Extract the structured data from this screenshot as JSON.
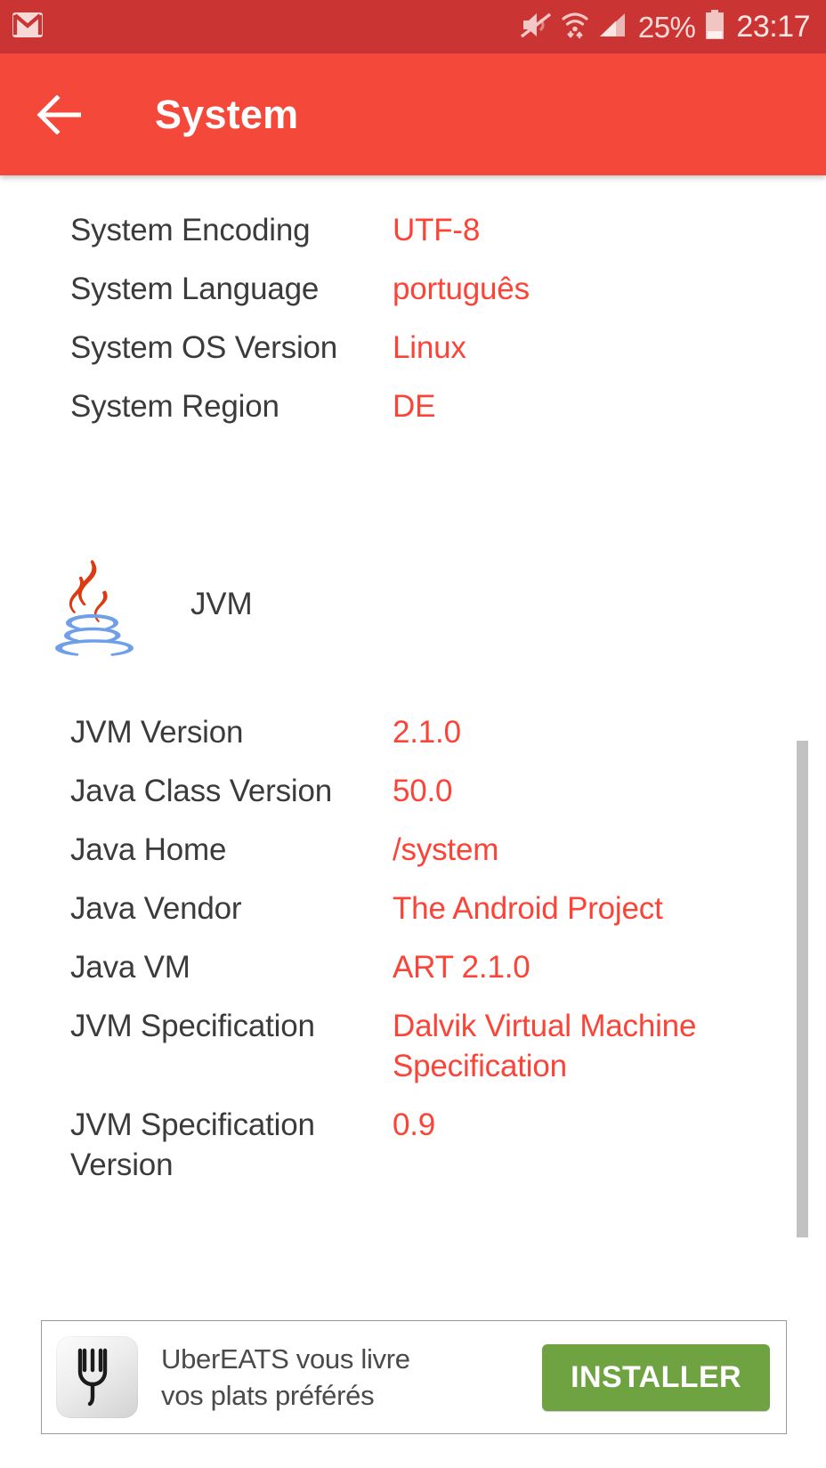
{
  "status_bar": {
    "background_color": "#ca3433",
    "notification_icon": "gmail-icon",
    "icons": [
      "mute-icon",
      "wifi-icon",
      "cellular-signal-icon"
    ],
    "battery_percent": "25%",
    "clock": "23:17"
  },
  "app_bar": {
    "background_color": "#f4493a",
    "back_icon": "back-arrow-icon",
    "title": "System"
  },
  "system_section": {
    "rows": [
      {
        "label": "System Encoding",
        "value": "UTF-8"
      },
      {
        "label": "System Language",
        "value": "português"
      },
      {
        "label": "System OS Version",
        "value": "Linux"
      },
      {
        "label": "System Region",
        "value": "DE"
      }
    ]
  },
  "jvm_section": {
    "icon": "java-logo-icon",
    "heading": "JVM",
    "rows": [
      {
        "label": "JVM Version",
        "value": "2.1.0"
      },
      {
        "label": "Java Class Version",
        "value": "50.0"
      },
      {
        "label": "Java Home",
        "value": "/system"
      },
      {
        "label": "Java Vendor",
        "value": "The Android Project"
      },
      {
        "label": "Java VM",
        "value": "ART 2.1.0"
      },
      {
        "label": "JVM Specification",
        "value": "Dalvik Virtual Machine Specification"
      },
      {
        "label": "JVM Specification Version",
        "value": "0.9"
      }
    ]
  },
  "ad": {
    "icon": "fork-icon",
    "line1": "UberEATS vous livre",
    "line2": "vos plats préférés",
    "install_label": "INSTALLER",
    "button_color": "#6fa342"
  },
  "colors": {
    "value_text": "#fb4337",
    "label_text": "#3b3b3b",
    "scrollbar": "#c2c2c2"
  }
}
